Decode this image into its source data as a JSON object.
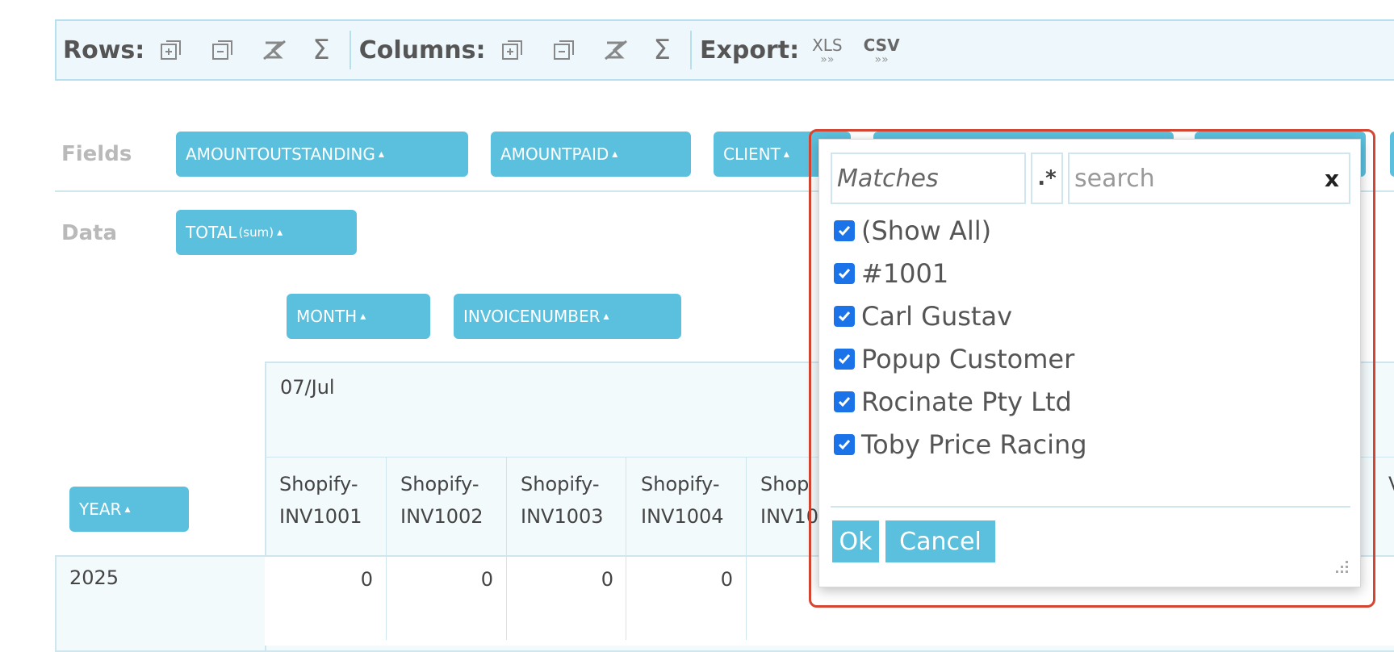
{
  "toolbar": {
    "rows_label": "Rows:",
    "columns_label": "Columns:",
    "export_label": "Export:",
    "sigma": "Σ",
    "xls_label": "XLS",
    "csv_label": "CSV",
    "arrows": "»»"
  },
  "fields": {
    "fields_label": "Fields",
    "data_label": "Data",
    "field_pills": [
      "AMOUNTOUTSTANDING",
      "AMOUNTPAID",
      "CLIENT"
    ],
    "data_pill": "TOTAL",
    "data_pill_agg": "(sum)",
    "column_pills": [
      "MONTH",
      "INVOICENUMBER"
    ],
    "row_pill": "YEAR",
    "sort_glyph": "▴"
  },
  "table": {
    "month": "07/Jul",
    "invoice_prefix": "Shopify-",
    "invoices": [
      "INV1001",
      "INV1002",
      "INV1003",
      "INV1004",
      "INV10"
    ],
    "partial_prefix": "Shop",
    "year": "2025",
    "values": [
      "0",
      "0",
      "0",
      "0"
    ],
    "partial_right_char": "V"
  },
  "filter_popup": {
    "mode": "Matches",
    "regex_toggle": ".*",
    "search_placeholder": "search",
    "clear": "x",
    "options": [
      {
        "label": "(Show All)",
        "checked": true
      },
      {
        "label": "#1001",
        "checked": true
      },
      {
        "label": "Carl Gustav",
        "checked": true
      },
      {
        "label": "Popup Customer",
        "checked": true
      },
      {
        "label": "Rocinate Pty Ltd",
        "checked": true
      },
      {
        "label": "Toby Price Racing",
        "checked": true
      }
    ],
    "ok_label": "Ok",
    "cancel_label": "Cancel"
  },
  "colors": {
    "accent": "#5bc0de",
    "highlight_border": "#d64531",
    "checkbox": "#1a73e8"
  }
}
